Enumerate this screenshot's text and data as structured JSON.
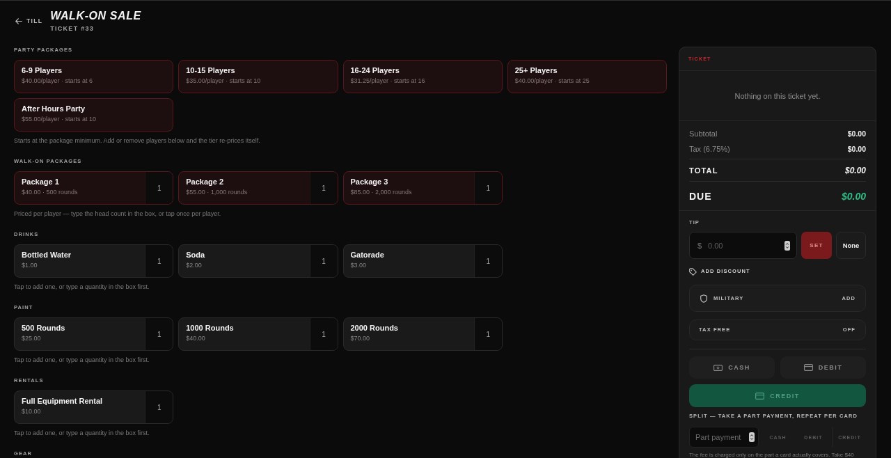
{
  "header": {
    "back_label": "TILL",
    "title": "WALK-ON SALE",
    "subtitle": "TICKET #33"
  },
  "sections": [
    {
      "heading": "PARTY PACKAGES",
      "kind": "party",
      "items": [
        {
          "name": "6-9 Players",
          "detail": "$40.00/player · starts at 6"
        },
        {
          "name": "10-15 Players",
          "detail": "$35.00/player · starts at 10"
        },
        {
          "name": "16-24 Players",
          "detail": "$31.25/player · starts at 16"
        },
        {
          "name": "25+ Players",
          "detail": "$40.00/player · starts at 25"
        },
        {
          "name": "After Hours Party",
          "detail": "$55.00/player · starts at 10"
        }
      ],
      "hint": "Starts at the package minimum. Add or remove players below and the tier re-prices itself."
    },
    {
      "heading": "WALK-ON PACKAGES",
      "kind": "package",
      "items": [
        {
          "name": "Package 1",
          "detail": "$40.00 · 500 rounds",
          "quantity": "1"
        },
        {
          "name": "Package 2",
          "detail": "$55.00 · 1,000 rounds",
          "quantity": "1"
        },
        {
          "name": "Package 3",
          "detail": "$85.00 · 2,000 rounds",
          "quantity": "1"
        }
      ],
      "hint": "Priced per player — type the head count in the box, or tap once per player."
    },
    {
      "heading": "DRINKS",
      "kind": "item",
      "items": [
        {
          "name": "Bottled Water",
          "detail": "$1.00",
          "quantity": "1"
        },
        {
          "name": "Soda",
          "detail": "$2.00",
          "quantity": "1"
        },
        {
          "name": "Gatorade",
          "detail": "$3.00",
          "quantity": "1"
        }
      ],
      "hint": "Tap to add one, or type a quantity in the box first."
    },
    {
      "heading": "PAINT",
      "kind": "item",
      "items": [
        {
          "name": "500 Rounds",
          "detail": "$25.00",
          "quantity": "1"
        },
        {
          "name": "1000 Rounds",
          "detail": "$40.00",
          "quantity": "1"
        },
        {
          "name": "2000 Rounds",
          "detail": "$70.00",
          "quantity": "1"
        }
      ],
      "hint": "Tap to add one, or type a quantity in the box first."
    },
    {
      "heading": "RENTALS",
      "kind": "item",
      "items": [
        {
          "name": "Full Equipment Rental",
          "detail": "$10.00",
          "quantity": "1"
        }
      ],
      "hint": "Tap to add one, or type a quantity in the box first."
    },
    {
      "heading": "GEAR",
      "kind": "item"
    }
  ],
  "ticket": {
    "title": "TICKET",
    "empty_message": "Nothing on this ticket yet.",
    "summary": [
      {
        "label": "Subtotal",
        "value": "$0.00",
        "kind": "line"
      },
      {
        "label": "Tax (6.75%)",
        "value": "$0.00",
        "kind": "line"
      },
      {
        "label": "TOTAL",
        "value": "$0.00",
        "kind": "total"
      },
      {
        "label": "DUE",
        "value": "$0.00",
        "kind": "due"
      }
    ],
    "tip": {
      "label": "TIP",
      "currency": "$",
      "placeholder": "0.00",
      "buttons": [
        {
          "label": "SET",
          "kind": "primary"
        },
        {
          "label": "None",
          "kind": "secondary"
        }
      ]
    },
    "discount": {
      "label": "ADD DISCOUNT",
      "options": [
        {
          "name": "MILITARY",
          "action": "ADD",
          "kind": "discount"
        },
        {
          "name": "TAX FREE",
          "action": "OFF",
          "kind": "toggle"
        }
      ]
    },
    "payment_methods": [
      {
        "label": "CASH",
        "kind": "cash",
        "selected": false
      },
      {
        "label": "DEBIT",
        "kind": "card",
        "selected": false
      },
      {
        "label": "CREDIT",
        "kind": "card",
        "selected": true
      }
    ],
    "split": {
      "label": "SPLIT — TAKE A PART PAYMENT, REPEAT PER CARD",
      "placeholder": "Part payment",
      "methods": [
        {
          "label": "CASH",
          "disabled": true
        },
        {
          "label": "DEBIT",
          "disabled": true
        },
        {
          "label": "CREDIT",
          "disabled": true
        }
      ],
      "note": "The fee is charged only on the part a card actually covers. Take $40"
    }
  }
}
